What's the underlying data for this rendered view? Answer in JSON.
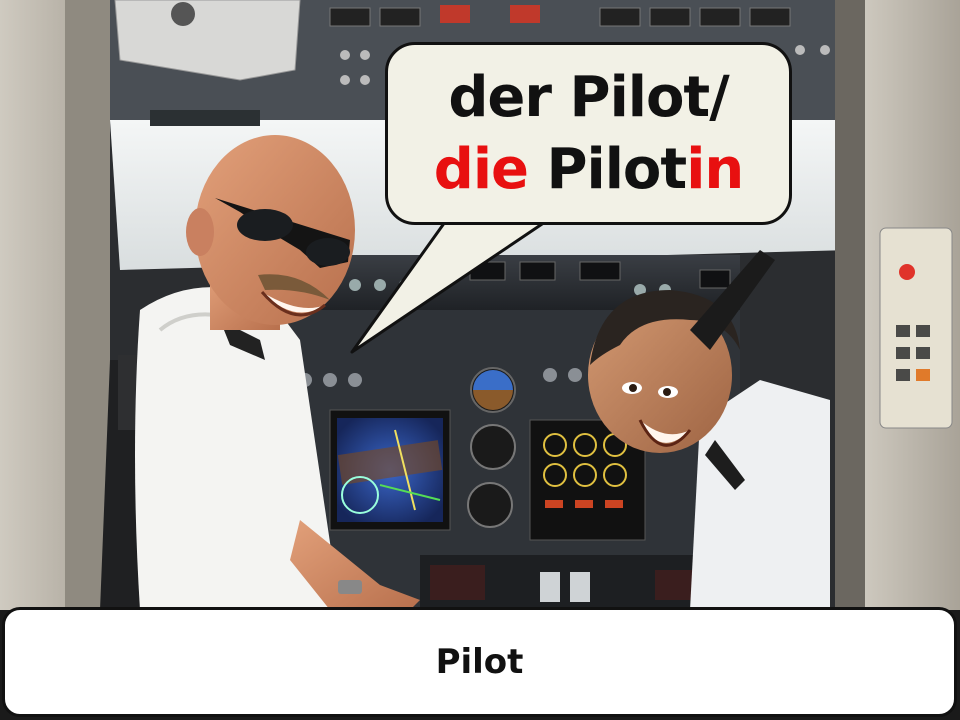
{
  "speech_bubble": {
    "line1": "der Pilot/",
    "line2_article": "die",
    "line2_stem": "Pilot",
    "line2_suffix": "in"
  },
  "caption": {
    "label": "Pilot"
  },
  "colors": {
    "highlight": "#e81010",
    "text": "#111111",
    "bubble_fill": "#f2f1e6"
  }
}
